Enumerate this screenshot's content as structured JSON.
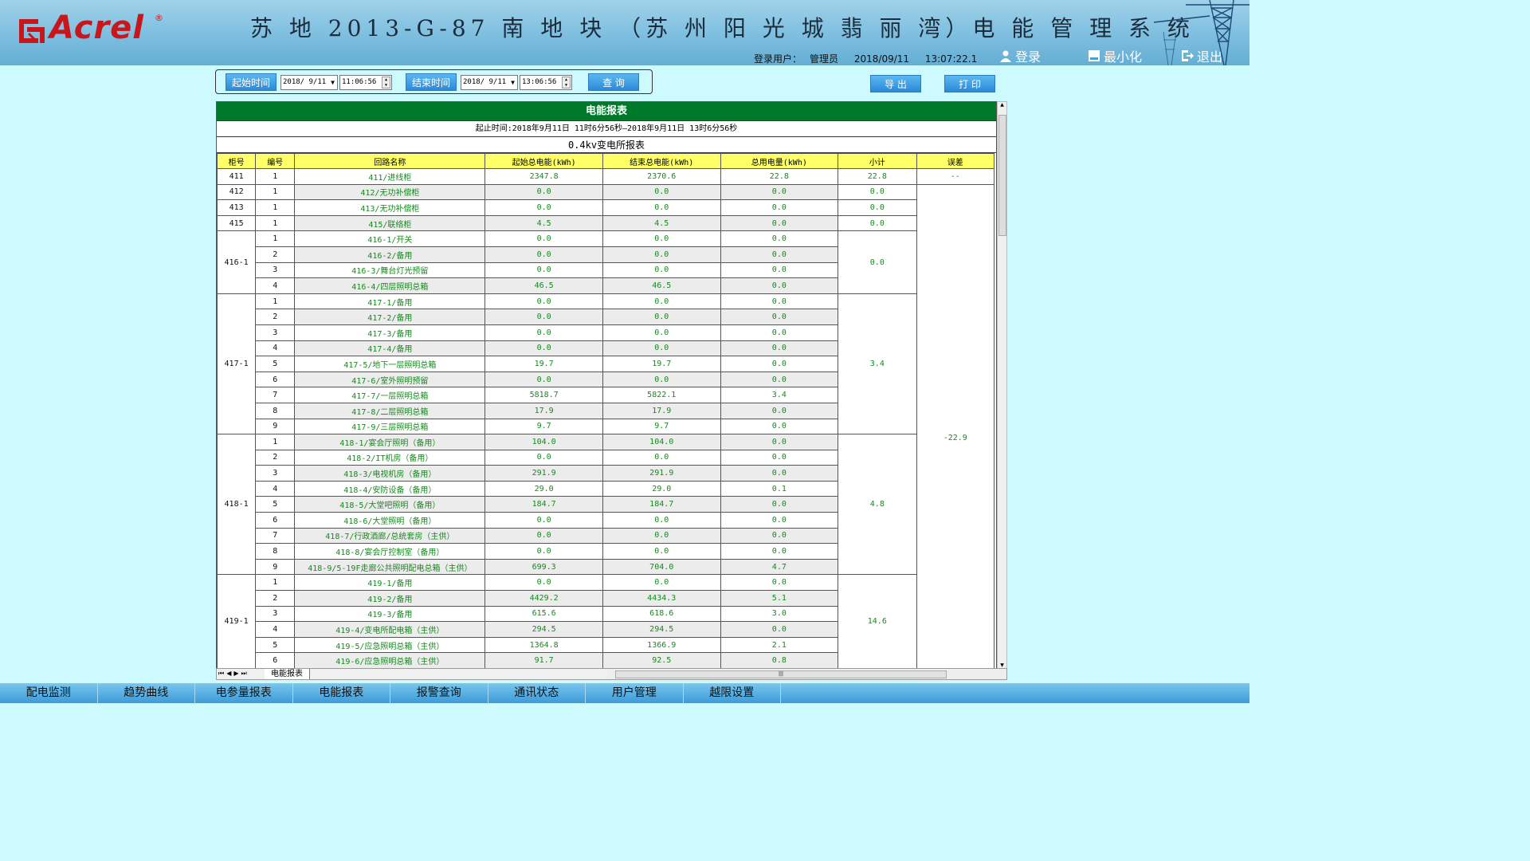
{
  "header": {
    "logo_text": "Acrel",
    "logo_reg": "®",
    "title": "苏 地 2013-G-87 南 地 块 （苏 州 阳 光 城 翡 丽 湾）电 能 管 理 系 统",
    "login_label": "登录用户：",
    "login_user": "管理员",
    "date": "2018/09/11",
    "time": "13:07:22.1",
    "login_btn": "登录",
    "minimize_btn": "最小化",
    "exit_btn": "退出"
  },
  "query": {
    "start_label": "起始时间",
    "start_date": "2018/ 9/11",
    "start_time": "11:06:56",
    "end_label": "结束时间",
    "end_date": "2018/ 9/11",
    "end_time": "13:06:56",
    "search_btn": "查 询",
    "export_btn": "导 出",
    "print_btn": "打 印"
  },
  "report": {
    "title": "电能报表",
    "time_range": "起止时间:2018年9月11日 11时6分56秒—2018年9月11日 13时6分56秒",
    "subtitle": "0.4kv变电所报表",
    "columns": [
      "柜号",
      "编号",
      "回路名称",
      "起始总电能(kWh)",
      "结束总电能(kWh)",
      "总用电量(kWh)",
      "小计",
      "误差"
    ],
    "rows": [
      [
        "411",
        "1",
        "411/进线柜",
        "2347.8",
        "2370.6",
        "22.8"
      ],
      [
        "412",
        "1",
        "412/无功补偿柜",
        "0.0",
        "0.0",
        "0.0"
      ],
      [
        "413",
        "1",
        "413/无功补偿柜",
        "0.0",
        "0.0",
        "0.0"
      ],
      [
        "415",
        "1",
        "415/联络柜",
        "4.5",
        "4.5",
        "0.0"
      ],
      [
        "416-1",
        "1",
        "416-1/开关",
        "0.0",
        "0.0",
        "0.0"
      ],
      [
        "",
        "2",
        "416-2/备用",
        "0.0",
        "0.0",
        "0.0"
      ],
      [
        "",
        "3",
        "416-3/舞台灯光预留",
        "0.0",
        "0.0",
        "0.0"
      ],
      [
        "",
        "4",
        "416-4/四层照明总箱",
        "46.5",
        "46.5",
        "0.0"
      ],
      [
        "417-1",
        "1",
        "417-1/备用",
        "0.0",
        "0.0",
        "0.0"
      ],
      [
        "",
        "2",
        "417-2/备用",
        "0.0",
        "0.0",
        "0.0"
      ],
      [
        "",
        "3",
        "417-3/备用",
        "0.0",
        "0.0",
        "0.0"
      ],
      [
        "",
        "4",
        "417-4/备用",
        "0.0",
        "0.0",
        "0.0"
      ],
      [
        "",
        "5",
        "417-5/地下一层照明总箱",
        "19.7",
        "19.7",
        "0.0"
      ],
      [
        "",
        "6",
        "417-6/室外照明预留",
        "0.0",
        "0.0",
        "0.0"
      ],
      [
        "",
        "7",
        "417-7/一层照明总箱",
        "5818.7",
        "5822.1",
        "3.4"
      ],
      [
        "",
        "8",
        "417-8/二层照明总箱",
        "17.9",
        "17.9",
        "0.0"
      ],
      [
        "",
        "9",
        "417-9/三层照明总箱",
        "9.7",
        "9.7",
        "0.0"
      ],
      [
        "418-1",
        "1",
        "418-1/宴会厅照明（备用）",
        "104.0",
        "104.0",
        "0.0"
      ],
      [
        "",
        "2",
        "418-2/IT机房（备用）",
        "0.0",
        "0.0",
        "0.0"
      ],
      [
        "",
        "3",
        "418-3/电视机房（备用）",
        "291.9",
        "291.9",
        "0.0"
      ],
      [
        "",
        "4",
        "418-4/安防设备（备用）",
        "29.0",
        "29.0",
        "0.1"
      ],
      [
        "",
        "5",
        "418-5/大堂吧照明（备用）",
        "184.7",
        "184.7",
        "0.0"
      ],
      [
        "",
        "6",
        "418-6/大堂照明（备用）",
        "0.0",
        "0.0",
        "0.0"
      ],
      [
        "",
        "7",
        "418-7/行政酒廊/总统套房（主供）",
        "0.0",
        "0.0",
        "0.0"
      ],
      [
        "",
        "8",
        "418-8/宴会厅控制室（备用）",
        "0.0",
        "0.0",
        "0.0"
      ],
      [
        "",
        "9",
        "418-9/5-19F走廊公共照明配电总箱（主供）",
        "699.3",
        "704.0",
        "4.7"
      ],
      [
        "419-1",
        "1",
        "419-1/备用",
        "0.0",
        "0.0",
        "0.0"
      ],
      [
        "",
        "2",
        "419-2/备用",
        "4429.2",
        "4434.3",
        "5.1"
      ],
      [
        "",
        "3",
        "419-3/备用",
        "615.6",
        "618.6",
        "3.0"
      ],
      [
        "",
        "4",
        "419-4/变电所配电箱（主供）",
        "294.5",
        "294.5",
        "0.0"
      ],
      [
        "",
        "5",
        "419-5/应急照明总箱（主供）",
        "1364.8",
        "1366.9",
        "2.1"
      ],
      [
        "",
        "6",
        "419-6/应急照明总箱（主供）",
        "91.7",
        "92.5",
        "0.8"
      ]
    ],
    "subtotals": {
      "411": "22.8",
      "412": "0.0",
      "413": "0.0",
      "415": "0.0",
      "416-1": "0.0",
      "417-1": "3.4",
      "418-1": "4.8",
      "419-1": "14.6"
    },
    "error_first": "--",
    "error_rest": "-22.9"
  },
  "sheet_tab": "电能报表",
  "nav": [
    "配电监测",
    "趋势曲线",
    "电参量报表",
    "电能报表",
    "报警查询",
    "通讯状态",
    "用户管理",
    "越限设置"
  ]
}
